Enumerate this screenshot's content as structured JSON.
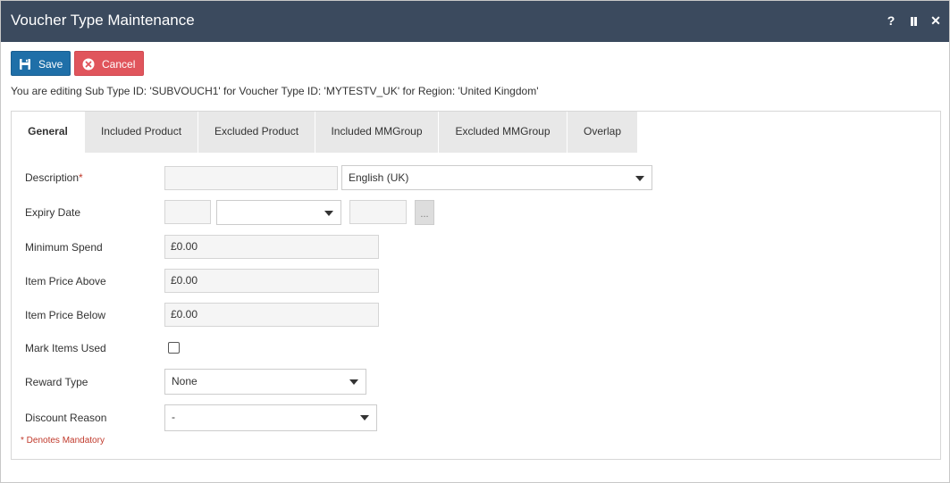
{
  "window": {
    "title": "Voucher Type Maintenance",
    "help_label": "?",
    "close_label": "✕"
  },
  "toolbar": {
    "save_label": "Save",
    "cancel_label": "Cancel"
  },
  "edit_info": "You are editing Sub Type ID: 'SUBVOUCH1' for Voucher Type ID: 'MYTESTV_UK' for Region: 'United Kingdom'",
  "tabs": [
    {
      "label": "General",
      "active": true
    },
    {
      "label": "Included Product",
      "active": false
    },
    {
      "label": "Excluded Product",
      "active": false
    },
    {
      "label": "Included MMGroup",
      "active": false
    },
    {
      "label": "Excluded MMGroup",
      "active": false
    },
    {
      "label": "Overlap",
      "active": false
    }
  ],
  "form": {
    "description": {
      "label": "Description",
      "required_mark": "*",
      "value": "",
      "language": "English (UK)"
    },
    "expiry_date": {
      "label": "Expiry Date",
      "day": "",
      "month": "",
      "year": "",
      "picker_label": "..."
    },
    "minimum_spend": {
      "label": "Minimum Spend",
      "value": "£0.00"
    },
    "item_price_above": {
      "label": "Item Price Above",
      "value": "£0.00"
    },
    "item_price_below": {
      "label": "Item Price Below",
      "value": "£0.00"
    },
    "mark_items_used": {
      "label": "Mark Items Used",
      "checked": false
    },
    "reward_type": {
      "label": "Reward Type",
      "value": "None"
    },
    "discount_reason": {
      "label": "Discount Reason",
      "value": "-"
    }
  },
  "mandatory_note": "* Denotes Mandatory",
  "colors": {
    "titlebar": "#3b4a5e",
    "save_button": "#1f6fa8",
    "cancel_button": "#e0555c",
    "required": "#c0392b"
  }
}
